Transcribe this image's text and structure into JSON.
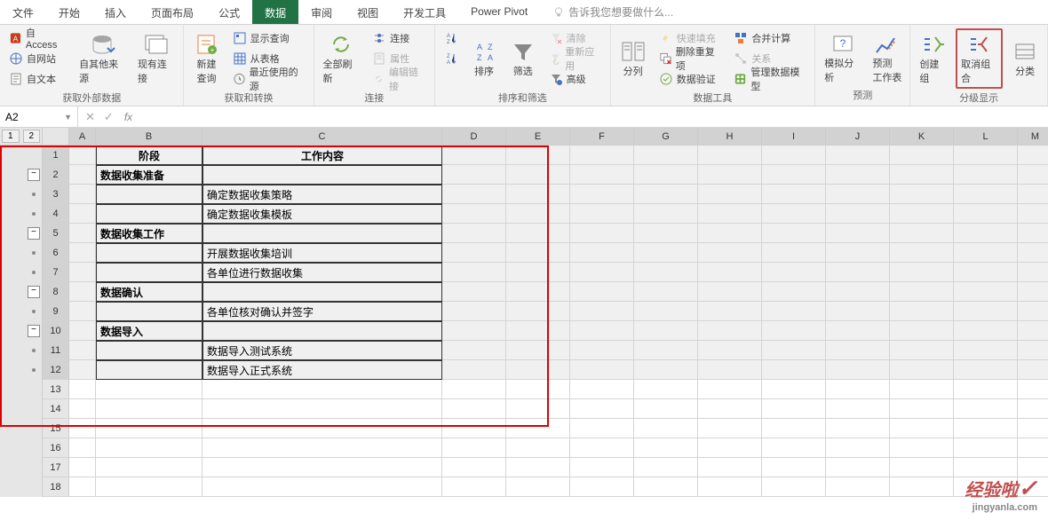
{
  "tabs": {
    "file": "文件",
    "home": "开始",
    "insert": "插入",
    "layout": "页面布局",
    "formula": "公式",
    "data": "数据",
    "review": "审阅",
    "view": "视图",
    "dev": "开发工具",
    "powerpivot": "Power Pivot",
    "tell_me": "告诉我您想要做什么..."
  },
  "ribbon": {
    "g1": {
      "label": "获取外部数据",
      "access": "自 Access",
      "web": "自网站",
      "text": "自文本",
      "other": "自其他来源",
      "existing": "现有连接"
    },
    "g2": {
      "label": "获取和转换",
      "new_query": "新建\n查询",
      "show_query": "显示查询",
      "from_table": "从表格",
      "recent": "最近使用的源"
    },
    "g3": {
      "label": "连接",
      "refresh_all": "全部刷新",
      "connections": "连接",
      "properties": "属性",
      "edit_links": "编辑链接"
    },
    "g4": {
      "label": "排序和筛选",
      "az": "A↓Z",
      "za": "Z↓A",
      "sort": "排序",
      "filter": "筛选",
      "clear": "清除",
      "reapply": "重新应用",
      "advanced": "高级"
    },
    "g5": {
      "label": "数据工具",
      "text_to_col": "分列",
      "flash_fill": "快速填充",
      "remove_dup": "删除重复项",
      "validation": "数据验证",
      "consolidate": "合并计算",
      "relations": "关系",
      "manage_model": "管理数据模型"
    },
    "g6": {
      "label": "预测",
      "whatif": "模拟分析",
      "forecast": "预测\n工作表"
    },
    "g7": {
      "label": "分级显示",
      "group": "创建组",
      "ungroup": "取消组合",
      "subtotal": "分类"
    }
  },
  "namebox": "A2",
  "outline_levels": [
    "1",
    "2"
  ],
  "columns": [
    "A",
    "B",
    "C",
    "D",
    "E",
    "F",
    "G",
    "H",
    "I",
    "J",
    "K",
    "L",
    "M"
  ],
  "rows": {
    "1": {
      "B": "阶段",
      "C": "工作内容"
    },
    "2": {
      "B": "数据收集准备"
    },
    "3": {
      "C": "确定数据收集策略"
    },
    "4": {
      "C": "确定数据收集模板"
    },
    "5": {
      "B": "数据收集工作"
    },
    "6": {
      "C": "开展数据收集培训"
    },
    "7": {
      "C": "各单位进行数据收集"
    },
    "8": {
      "B": "数据确认"
    },
    "9": {
      "C": "各单位核对确认并签字"
    },
    "10": {
      "B": "数据导入"
    },
    "11": {
      "C": "数据导入测试系统"
    },
    "12": {
      "C": "数据导入正式系统"
    }
  },
  "outline_rows": {
    "2": "minus",
    "3": "dot",
    "4": "dot",
    "5": "minus",
    "6": "dot",
    "7": "dot",
    "8": "minus",
    "9": "dot",
    "10": "minus",
    "11": "dot",
    "12": "dot"
  },
  "watermark": {
    "main": "经验啦",
    "sub": "jingyanla.com"
  }
}
